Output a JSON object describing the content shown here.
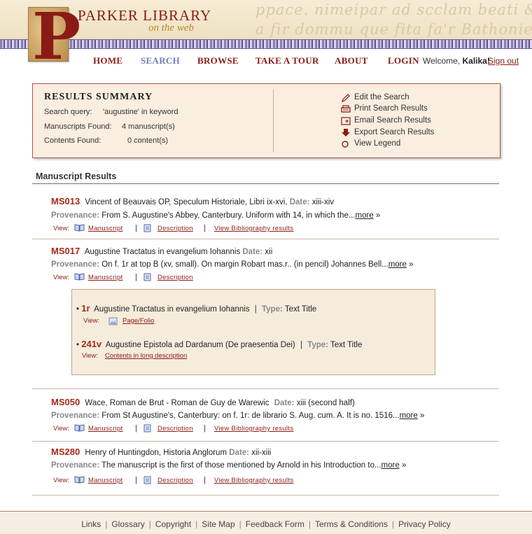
{
  "header": {
    "logo_letter": "P",
    "title": "PARKER LIBRARY",
    "subtitle": "on the web",
    "script_line_1": "ppace. nimeipar ad scclam beati & pfaci scclae",
    "script_line_2": "a fir dommu que fita fa'r Bathonie p condial"
  },
  "nav": {
    "items": [
      "HOME",
      "SEARCH",
      "BROWSE",
      "TAKE A TOUR",
      "ABOUT",
      "LOGIN"
    ],
    "active": "SEARCH",
    "welcome_prefix": "Welcome,",
    "user": "Kalika!",
    "signout": "Sign out"
  },
  "summary": {
    "title": "RESULTS SUMMARY",
    "query_label": "Search query:",
    "query_value": "'augustine' in keyword",
    "manuscripts_label": "Manuscripts Found:",
    "manuscripts_value": "4 manuscript(s)",
    "contents_label": "Contents Found:",
    "contents_value": "0 content(s)",
    "actions": [
      {
        "label": "Edit the Search",
        "icon": "pencil-icon"
      },
      {
        "label": "Print Search Results",
        "icon": "printer-icon"
      },
      {
        "label": "Email Search Results",
        "icon": "email-icon"
      },
      {
        "label": "Export Search Results",
        "icon": "export-arrow-icon"
      },
      {
        "label": "View Legend",
        "icon": "circle-icon"
      }
    ]
  },
  "results": {
    "title": "Manuscript Results",
    "provenance_label": "Provenance:",
    "date_label": "Date:",
    "view_label": "View:",
    "more_label": "more",
    "more_suffix": "»",
    "link_manuscript": "Manuscript",
    "link_description": "Description",
    "link_bibliography": "View Bibliography results",
    "items": [
      {
        "id": "MS013",
        "title": "Vincent of Beauvais OP, Speculum Historiale, Libri ix-xvi,",
        "date": "xiii-xiv",
        "provenance": "From S. Augustine's Abbey, Canterbury. Uniform with 14, in which the...",
        "has_bibliography": true
      },
      {
        "id": "MS017",
        "title": "Augustine Tractatus in evangelium Iohannis",
        "date": "xii",
        "provenance": "On f. 1r at top B (xv, small). On margin Robart mas.r.. (in pencil) Johannes Bell...",
        "has_bibliography": false
      },
      {
        "id": "MS050",
        "title": "Wace, Roman de Brut - Roman de Guy de Warewic",
        "date": "xiii (second half)",
        "provenance": "From St Augustine's, Canterbury: on f. 1r: de librario S. Aug. cum. A. It is no. 1516...",
        "has_bibliography": true
      },
      {
        "id": "MS280",
        "title": "Henry of Huntingdon, Historia Anglorum",
        "date": "xii-xiii",
        "provenance": "The manuscript is the first of those mentioned by Arnold in his Introduction to...",
        "has_bibliography": true
      }
    ],
    "contents": [
      {
        "bullet": "•",
        "id": "1r",
        "title": "Augustine Tractatus in evangelium Iohannis",
        "type_label": "Type:",
        "type": "Text Title",
        "view_label": "View:",
        "link": "Page/Folio"
      },
      {
        "bullet": "•",
        "id": "241v",
        "title": "Augustine Epistola ad Dardanum (De praesentia Dei)",
        "type_label": "Type:",
        "type": "Text Title",
        "view_label": "View:",
        "link": "Contents in long description"
      }
    ]
  },
  "footer": {
    "links": [
      "Links",
      "Glossary",
      "Copyright",
      "Site Map",
      "Feedback Form",
      "Terms & Conditions",
      "Privacy Policy"
    ]
  },
  "colors": {
    "brand_red": "#8a1b14",
    "ms_id_red": "#a8281a",
    "active_nav": "#6b7fb8",
    "summary_bg": "#faeee0",
    "summary_border": "#a7574c"
  }
}
